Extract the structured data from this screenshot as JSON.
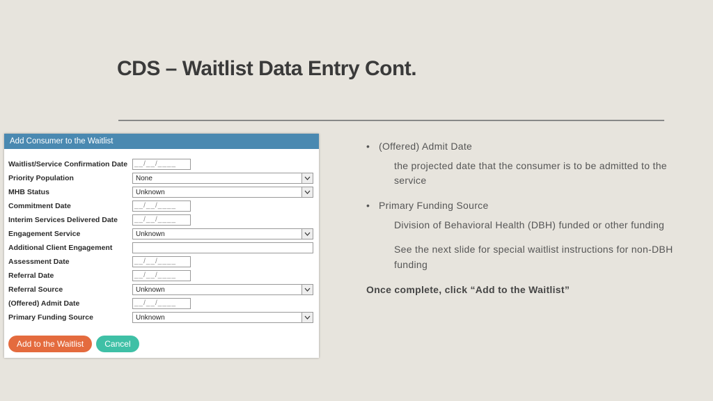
{
  "title": "CDS – Waitlist Data Entry Cont.",
  "panel": {
    "header": "Add Consumer to the Waitlist",
    "date_placeholder": "__/__/____",
    "fields": {
      "f1": {
        "label": "Waitlist/Service Confirmation Date"
      },
      "f2": {
        "label": "Priority Population",
        "value": "None"
      },
      "f3": {
        "label": "MHB Status",
        "value": "Unknown"
      },
      "f4": {
        "label": "Commitment Date"
      },
      "f5": {
        "label": "Interim Services Delivered Date"
      },
      "f6": {
        "label": "Engagement Service",
        "value": "Unknown"
      },
      "f7": {
        "label": "Additional Client Engagement"
      },
      "f8": {
        "label": "Assessment Date"
      },
      "f9": {
        "label": "Referral Date"
      },
      "f10": {
        "label": "Referral Source",
        "value": "Unknown"
      },
      "f11": {
        "label": "(Offered) Admit Date"
      },
      "f12": {
        "label": "Primary Funding Source",
        "value": "Unknown"
      }
    },
    "buttons": {
      "add": "Add to the Waitlist",
      "cancel": "Cancel"
    }
  },
  "notes": {
    "b1": "(Offered) Admit Date",
    "b1s": "the projected date that the consumer is to be admitted to the service",
    "b2": "Primary Funding Source",
    "b2s1": "Division of Behavioral Health (DBH) funded or other funding",
    "b2s2": "See the next slide for special waitlist instructions for non-DBH funding",
    "conc": "Once complete, click “Add to the Waitlist”"
  }
}
